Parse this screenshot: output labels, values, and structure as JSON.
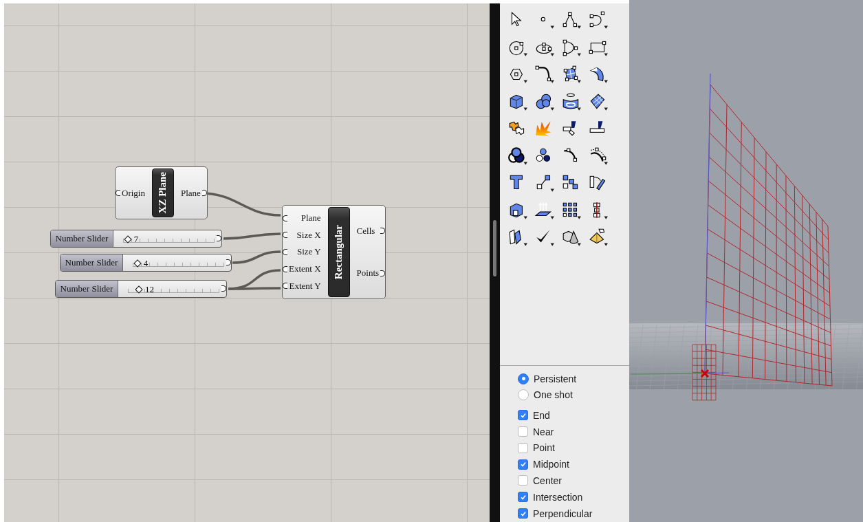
{
  "canvas": {
    "components": [
      {
        "title": "XZ Plane",
        "inputs": [
          "Origin"
        ],
        "outputs": [
          "Plane"
        ]
      },
      {
        "title": "Rectangular",
        "inputs": [
          "Plane",
          "Size X",
          "Size Y",
          "Extent X",
          "Extent Y"
        ],
        "outputs": [
          "Cells",
          "Points"
        ]
      }
    ],
    "sliders": [
      {
        "label": "Number Slider",
        "value": "7",
        "level": 0.05
      },
      {
        "label": "Number Slider",
        "value": "4",
        "level": 0.05
      },
      {
        "label": "Number Slider",
        "value": "12",
        "level": 0.12
      }
    ]
  },
  "osnap": {
    "modes": [
      {
        "label": "Persistent",
        "selected": true
      },
      {
        "label": "One shot",
        "selected": false
      }
    ],
    "snaps": [
      {
        "label": "End",
        "checked": true
      },
      {
        "label": "Near",
        "checked": false
      },
      {
        "label": "Point",
        "checked": false
      },
      {
        "label": "Midpoint",
        "checked": true
      },
      {
        "label": "Center",
        "checked": false
      },
      {
        "label": "Intersection",
        "checked": true
      },
      {
        "label": "Perpendicular",
        "checked": true
      }
    ]
  }
}
